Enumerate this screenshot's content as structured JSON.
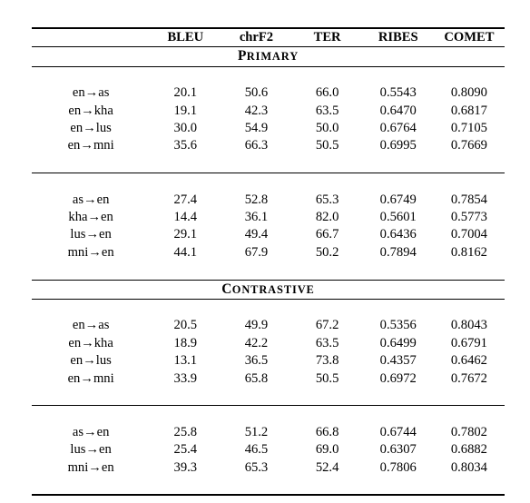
{
  "table": {
    "columns": [
      {
        "key": "direction",
        "label": ""
      },
      {
        "key": "bleu",
        "label": "BLEU"
      },
      {
        "key": "chrf2",
        "label": "chrF2"
      },
      {
        "key": "ter",
        "label": "TER"
      },
      {
        "key": "ribes",
        "label": "RIBES"
      },
      {
        "key": "comet",
        "label": "COMET"
      }
    ],
    "sections": [
      {
        "title": "Primary",
        "title_first": "P",
        "title_rest": "RIMARY",
        "groups": [
          {
            "rows": [
              {
                "source": "en",
                "arrow": "→",
                "target": "as",
                "direction": "en→as",
                "bleu": "20.1",
                "chrf2": "50.6",
                "ter": "66.0",
                "ribes": "0.5543",
                "comet": "0.8090"
              },
              {
                "source": "en",
                "arrow": "→",
                "target": "kha",
                "direction": "en→kha",
                "bleu": "19.1",
                "chrf2": "42.3",
                "ter": "63.5",
                "ribes": "0.6470",
                "comet": "0.6817"
              },
              {
                "source": "en",
                "arrow": "→",
                "target": "lus",
                "direction": "en→lus",
                "bleu": "30.0",
                "chrf2": "54.9",
                "ter": "50.0",
                "ribes": "0.6764",
                "comet": "0.7105"
              },
              {
                "source": "en",
                "arrow": "→",
                "target": "mni",
                "direction": "en→mni",
                "bleu": "35.6",
                "chrf2": "66.3",
                "ter": "50.5",
                "ribes": "0.6995",
                "comet": "0.7669"
              }
            ]
          },
          {
            "rows": [
              {
                "source": "as",
                "arrow": "→",
                "target": "en",
                "direction": "as→en",
                "bleu": "27.4",
                "chrf2": "52.8",
                "ter": "65.3",
                "ribes": "0.6749",
                "comet": "0.7854"
              },
              {
                "source": "kha",
                "arrow": "→",
                "target": "en",
                "direction": "kha→en",
                "bleu": "14.4",
                "chrf2": "36.1",
                "ter": "82.0",
                "ribes": "0.5601",
                "comet": "0.5773"
              },
              {
                "source": "lus",
                "arrow": "→",
                "target": "en",
                "direction": "lus→en",
                "bleu": "29.1",
                "chrf2": "49.4",
                "ter": "66.7",
                "ribes": "0.6436",
                "comet": "0.7004"
              },
              {
                "source": "mni",
                "arrow": "→",
                "target": "en",
                "direction": "mni→en",
                "bleu": "44.1",
                "chrf2": "67.9",
                "ter": "50.2",
                "ribes": "0.7894",
                "comet": "0.8162"
              }
            ]
          }
        ]
      },
      {
        "title": "Contrastive",
        "title_first": "C",
        "title_rest": "ONTRASTIVE",
        "groups": [
          {
            "rows": [
              {
                "source": "en",
                "arrow": "→",
                "target": "as",
                "direction": "en→as",
                "bleu": "20.5",
                "chrf2": "49.9",
                "ter": "67.2",
                "ribes": "0.5356",
                "comet": "0.8043"
              },
              {
                "source": "en",
                "arrow": "→",
                "target": "kha",
                "direction": "en→kha",
                "bleu": "18.9",
                "chrf2": "42.2",
                "ter": "63.5",
                "ribes": "0.6499",
                "comet": "0.6791"
              },
              {
                "source": "en",
                "arrow": "→",
                "target": "lus",
                "direction": "en→lus",
                "bleu": "13.1",
                "chrf2": "36.5",
                "ter": "73.8",
                "ribes": "0.4357",
                "comet": "0.6462"
              },
              {
                "source": "en",
                "arrow": "→",
                "target": "mni",
                "direction": "en→mni",
                "bleu": "33.9",
                "chrf2": "65.8",
                "ter": "50.5",
                "ribes": "0.6972",
                "comet": "0.7672"
              }
            ]
          },
          {
            "rows": [
              {
                "source": "as",
                "arrow": "→",
                "target": "en",
                "direction": "as→en",
                "bleu": "25.8",
                "chrf2": "51.2",
                "ter": "66.8",
                "ribes": "0.6744",
                "comet": "0.7802"
              },
              {
                "source": "lus",
                "arrow": "→",
                "target": "en",
                "direction": "lus→en",
                "bleu": "25.4",
                "chrf2": "46.5",
                "ter": "69.0",
                "ribes": "0.6307",
                "comet": "0.6882"
              },
              {
                "source": "mni",
                "arrow": "→",
                "target": "en",
                "direction": "mni→en",
                "bleu": "39.3",
                "chrf2": "65.3",
                "ter": "52.4",
                "ribes": "0.7806",
                "comet": "0.8034"
              }
            ]
          }
        ]
      }
    ]
  }
}
